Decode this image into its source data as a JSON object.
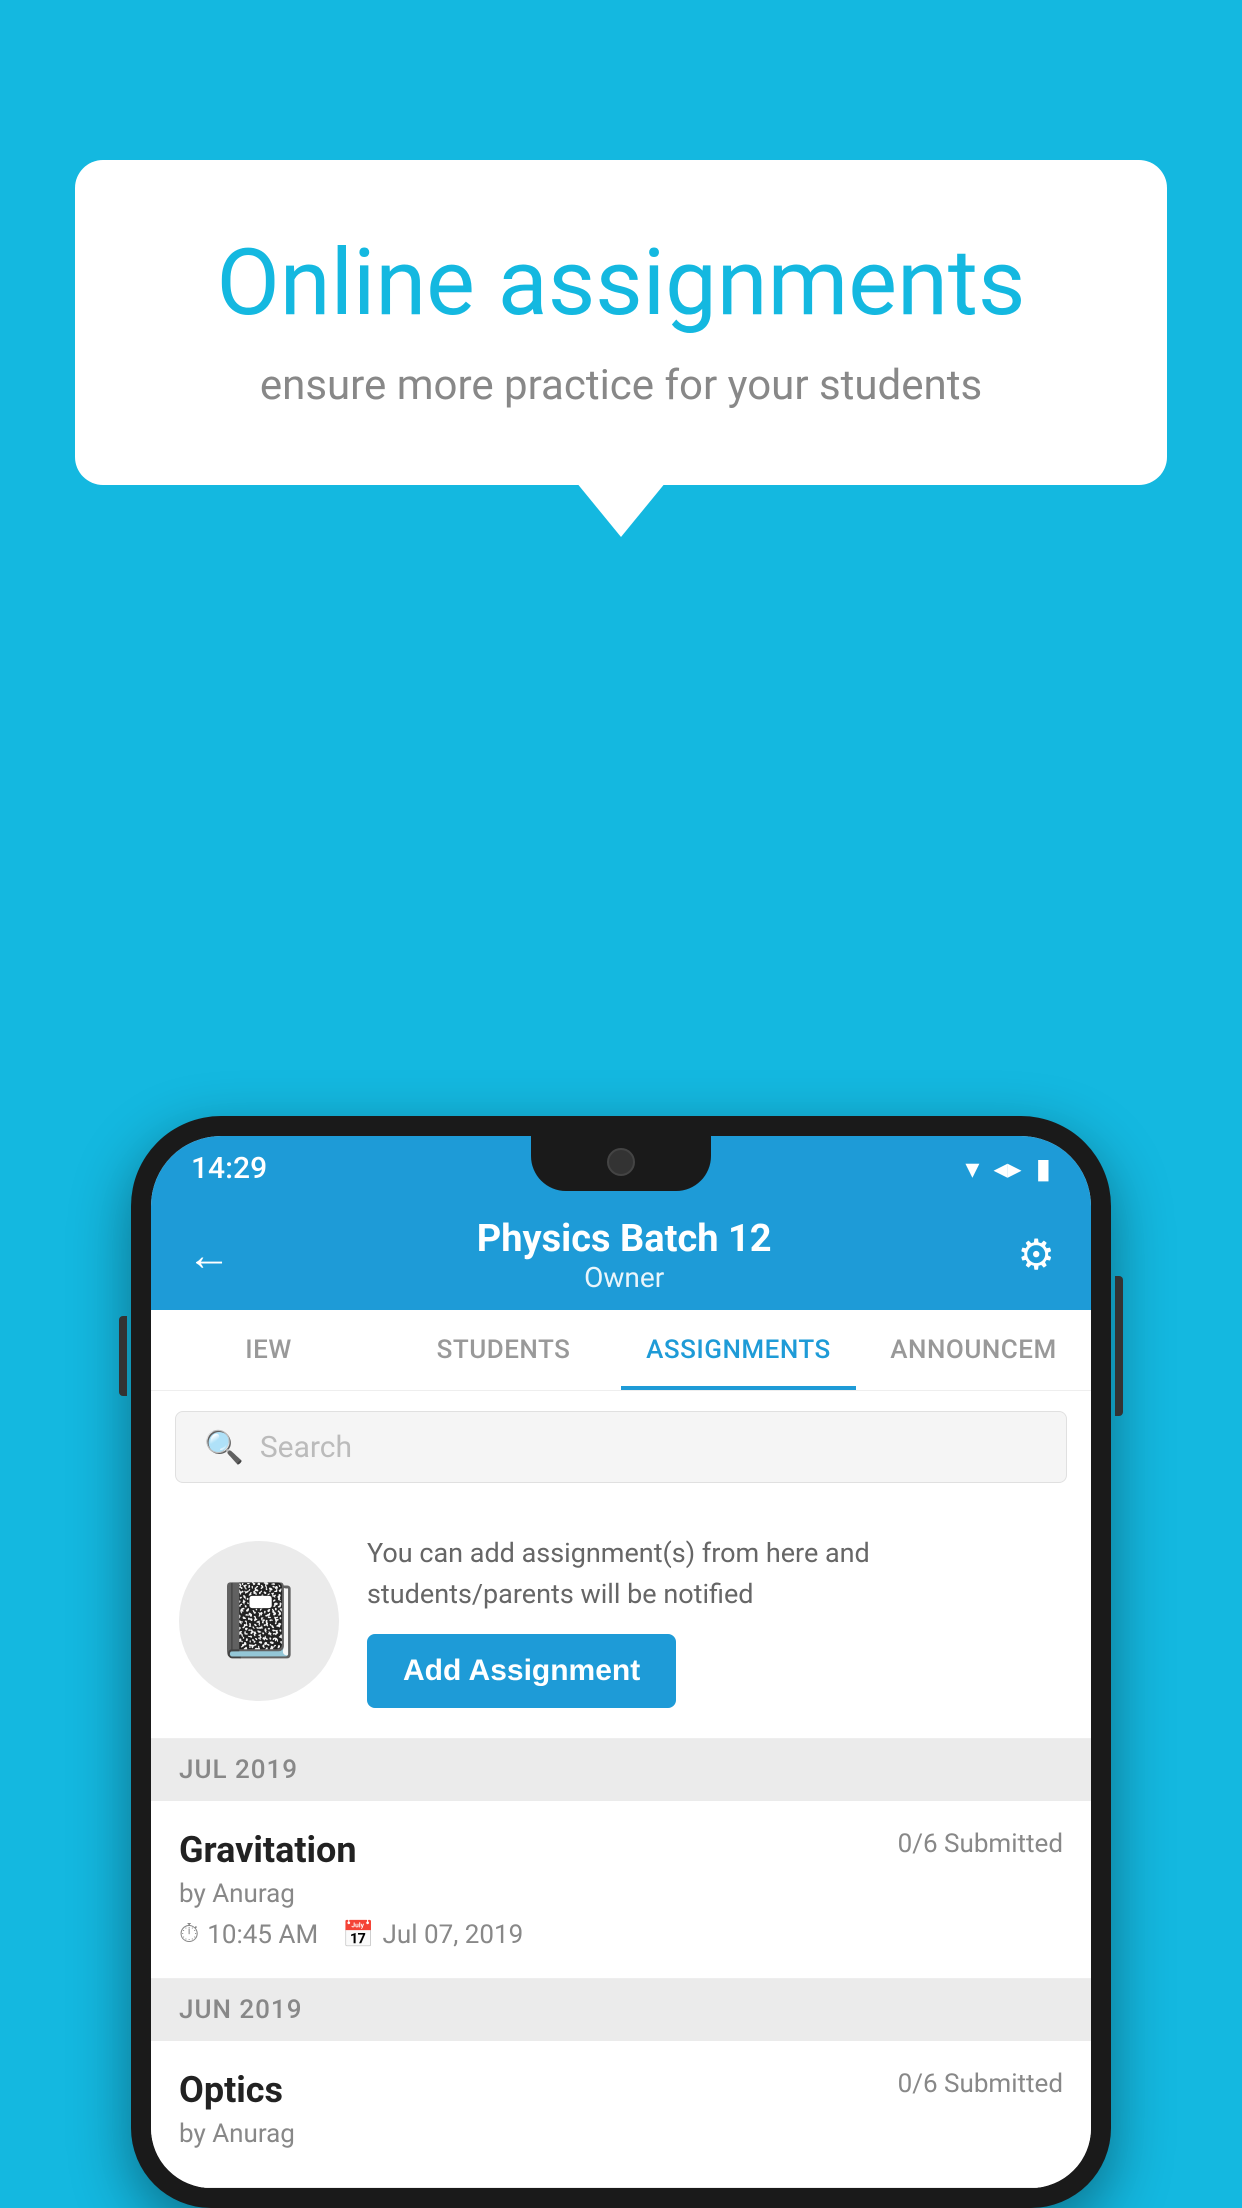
{
  "background": {
    "color": "#14B8E0"
  },
  "speech_bubble": {
    "title": "Online assignments",
    "subtitle": "ensure more practice for your students"
  },
  "status_bar": {
    "time": "14:29",
    "wifi": "▾",
    "signal": "▲",
    "battery": "▮"
  },
  "header": {
    "title": "Physics Batch 12",
    "subtitle": "Owner",
    "back_label": "←",
    "settings_label": "⚙"
  },
  "tabs": [
    {
      "label": "IEW",
      "active": false
    },
    {
      "label": "STUDENTS",
      "active": false
    },
    {
      "label": "ASSIGNMENTS",
      "active": true
    },
    {
      "label": "ANNOUNCEM",
      "active": false
    }
  ],
  "search": {
    "placeholder": "Search"
  },
  "promo": {
    "description": "You can add assignment(s) from here and students/parents will be notified",
    "button_label": "Add Assignment"
  },
  "sections": [
    {
      "label": "JUL 2019",
      "assignments": [
        {
          "name": "Gravitation",
          "submitted": "0/6 Submitted",
          "by": "by Anurag",
          "time": "10:45 AM",
          "date": "Jul 07, 2019"
        }
      ]
    },
    {
      "label": "JUN 2019",
      "assignments": [
        {
          "name": "Optics",
          "submitted": "0/6 Submitted",
          "by": "by Anurag",
          "time": "",
          "date": ""
        }
      ]
    }
  ]
}
